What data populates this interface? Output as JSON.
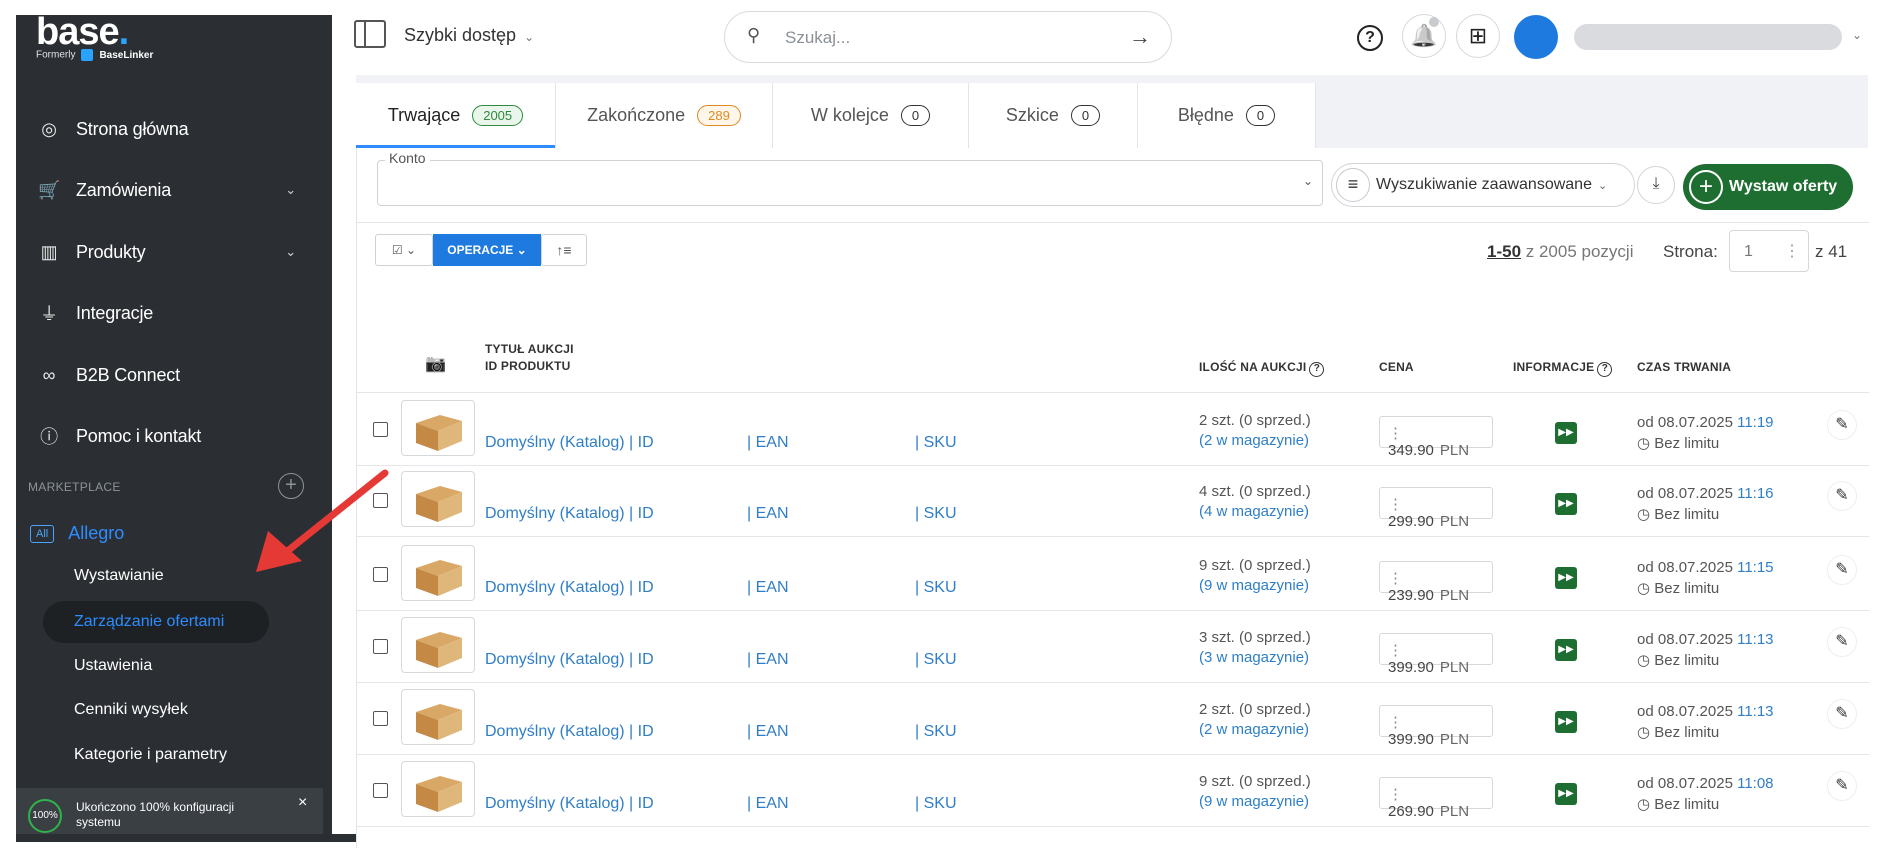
{
  "brand": {
    "logo": "base",
    "logo_dot": ".",
    "formerly": "Formerly",
    "formerly_brand": "BaseLinker"
  },
  "sidebar": {
    "items": [
      {
        "label": "Strona główna",
        "icon": "dashboard-icon"
      },
      {
        "label": "Zamówienia",
        "icon": "cart-icon",
        "chevron": "⌄"
      },
      {
        "label": "Produkty",
        "icon": "warehouse-icon",
        "chevron": "⌄"
      },
      {
        "label": "Integracje",
        "icon": "plug-icon"
      },
      {
        "label": "B2B Connect",
        "icon": "link-icon"
      },
      {
        "label": "Pomoc i kontakt",
        "icon": "help-circle-icon"
      }
    ],
    "marketplace_label": "MARKETPLACE",
    "marketplace_add": "+",
    "all_badge": "All",
    "marketplace_name": "Allegro",
    "sub_items": [
      "Wystawianie",
      "Zarządzanie ofertami",
      "Ustawienia",
      "Cenniki wysyłek",
      "Kategorie i parametry"
    ],
    "active_sub": "Zarządzanie ofertami",
    "config_progress": "100%",
    "config_text": "Ukończono 100% konfiguracji systemu",
    "close": "×"
  },
  "header": {
    "quick_access": "Szybki dostęp",
    "quick_chevron": "⌄",
    "search_placeholder": "Szukaj...",
    "search_arrow": "→",
    "help": "?",
    "bell": "🔔",
    "apps": "⊞",
    "name_chevron": "⌄"
  },
  "tabs": [
    {
      "label": "Trwające",
      "count": "2005",
      "active": true
    },
    {
      "label": "Zakończone",
      "count": "289"
    },
    {
      "label": "W kolejce",
      "count": "0"
    },
    {
      "label": "Szkice",
      "count": "0"
    },
    {
      "label": "Błędne",
      "count": "0"
    }
  ],
  "filters": {
    "konto_label": "Konto",
    "konto_chevron": "⌄",
    "advanced": "Wyszukiwanie zaawansowane",
    "advanced_chevron": "⌄",
    "download": "⤓",
    "publish": "Wystaw oferty",
    "publish_plus": "+"
  },
  "toolbar": {
    "check": "☑ ⌄",
    "operations": "OPERACJE ⌄",
    "sort": "↑≡",
    "range_bold": "1-50",
    "range_rest": " z 2005 pozycji",
    "page_label": "Strona:",
    "page_value": "1",
    "page_dots": "⋮",
    "page_total": "z 41"
  },
  "table": {
    "camera": "📷",
    "col_title": "TYTUŁ AUKCJI",
    "col_id": "ID PRODUKTU",
    "col_qty": "ILOŚĆ NA AUKCJI",
    "col_price": "CENA",
    "col_info": "INFORMACJE",
    "col_duration": "CZAS TRWANIA",
    "q": "?",
    "rows": [
      {
        "link1": "Domyślny (Katalog) | ID",
        "link2": "| EAN",
        "link3": "| SKU",
        "qty": "2 szt. (0 sprzed.)",
        "stock": "(2 w magazynie)",
        "price": "349.90",
        "currency": "PLN",
        "date": "od 08.07.2025 ",
        "time": "11:19",
        "limit": "◷ Bez limitu"
      },
      {
        "link1": "Domyślny (Katalog) | ID",
        "link2": "| EAN",
        "link3": "| SKU",
        "qty": "4 szt. (0 sprzed.)",
        "stock": "(4 w magazynie)",
        "price": "299.90",
        "currency": "PLN",
        "date": "od 08.07.2025 ",
        "time": "11:16",
        "limit": "◷ Bez limitu"
      },
      {
        "link1": "Domyślny (Katalog) | ID",
        "link2": "| EAN",
        "link3": "| SKU",
        "qty": "9 szt. (0 sprzed.)",
        "stock": "(9 w magazynie)",
        "price": "239.90",
        "currency": "PLN",
        "date": "od 08.07.2025 ",
        "time": "11:15",
        "limit": "◷ Bez limitu"
      },
      {
        "link1": "Domyślny (Katalog) | ID",
        "link2": "| EAN",
        "link3": "| SKU",
        "qty": "3 szt. (0 sprzed.)",
        "stock": "(3 w magazynie)",
        "price": "399.90",
        "currency": "PLN",
        "date": "od 08.07.2025 ",
        "time": "11:13",
        "limit": "◷ Bez limitu"
      },
      {
        "link1": "Domyślny (Katalog) | ID",
        "link2": "| EAN",
        "link3": "| SKU",
        "qty": "2 szt. (0 sprzed.)",
        "stock": "(2 w magazynie)",
        "price": "399.90",
        "currency": "PLN",
        "date": "od 08.07.2025 ",
        "time": "11:13",
        "limit": "◷ Bez limitu"
      },
      {
        "link1": "Domyślny (Katalog) | ID",
        "link2": "| EAN",
        "link3": "| SKU",
        "qty": "9 szt. (0 sprzed.)",
        "stock": "(9 w magazynie)",
        "price": "269.90",
        "currency": "PLN",
        "date": "od 08.07.2025 ",
        "time": "11:08",
        "limit": "◷ Bez limitu"
      }
    ],
    "info_icon": "▶▶",
    "edit_icon": "✎"
  },
  "colors": {
    "sidebar": "#2b2f33",
    "accent": "#2f8cff",
    "green": "#1e6e32",
    "annotation": "#e53935"
  }
}
